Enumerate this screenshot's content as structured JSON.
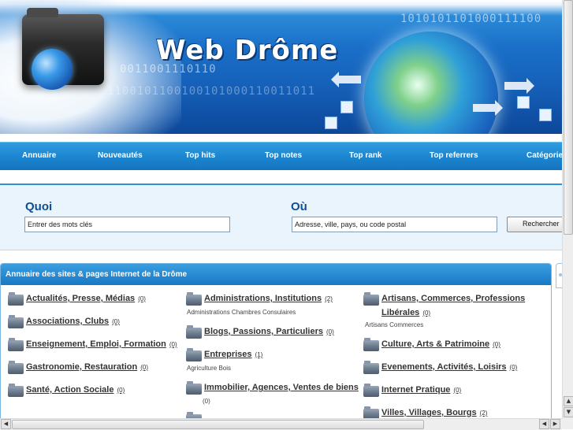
{
  "banner": {
    "site_title": "Web Drôme",
    "binary_1": "1010101101000111100",
    "binary_2": "0011001110110",
    "binary_3": "1100101100100101000110011011"
  },
  "nav": {
    "items": [
      {
        "label": "Annuaire"
      },
      {
        "label": "Nouveautés"
      },
      {
        "label": "Top hits"
      },
      {
        "label": "Top notes"
      },
      {
        "label": "Top rank"
      },
      {
        "label": "Top referrers"
      },
      {
        "label": "Catégories"
      }
    ]
  },
  "search": {
    "quoi_label": "Quoi",
    "quoi_value": "Entrer des mots clés",
    "ou_label": "Où",
    "ou_value": "Adresse, ville, pays, ou code postal",
    "button_label": "Rechercher"
  },
  "directory": {
    "title": "Annuaire des sites & pages Internet de la Drôme",
    "col1": [
      {
        "name": "Actualités, Presse, Médias",
        "count": "(0)"
      },
      {
        "name": "Associations, Clubs",
        "count": "(0)"
      },
      {
        "name": "Enseignement, Emploi, Formation",
        "count": "(0)"
      },
      {
        "name": "Gastronomie, Restauration",
        "count": "(0)"
      },
      {
        "name": "Santé, Action Sociale",
        "count": "(0)"
      }
    ],
    "col2": [
      {
        "name": "Administrations, Institutions",
        "count": "(2)",
        "sub": "Administrations   Chambres Consulaires"
      },
      {
        "name": "Blogs, Passions, Particuliers",
        "count": "(0)"
      },
      {
        "name": "Entreprises",
        "count": "(1)",
        "sub": "Agriculture   Bois"
      },
      {
        "name": "Immobilier, Agences, Ventes de biens",
        "count": "(0)"
      }
    ],
    "col3": [
      {
        "name": "Artisans, Commerces, Professions",
        "name2": "Libérales",
        "count": "(0)",
        "sub": "Artisans   Commerces"
      },
      {
        "name": "Culture, Arts & Patrimoine",
        "count": "(0)"
      },
      {
        "name": "Evenements, Activités, Loisirs",
        "count": "(0)"
      },
      {
        "name": "Internet Pratique",
        "count": "(0)"
      },
      {
        "name": "Villes, Villages, Bourgs",
        "count": "(2)"
      }
    ]
  },
  "scrollbars": {
    "up_arrow": "▲",
    "down_arrow": "▼",
    "left_arrow": "◀",
    "right_arrow": "▶"
  },
  "colors": {
    "nav_bg": "#1d86d0",
    "heading_blue": "#0d4f94",
    "panel_header": "#1878c4"
  }
}
